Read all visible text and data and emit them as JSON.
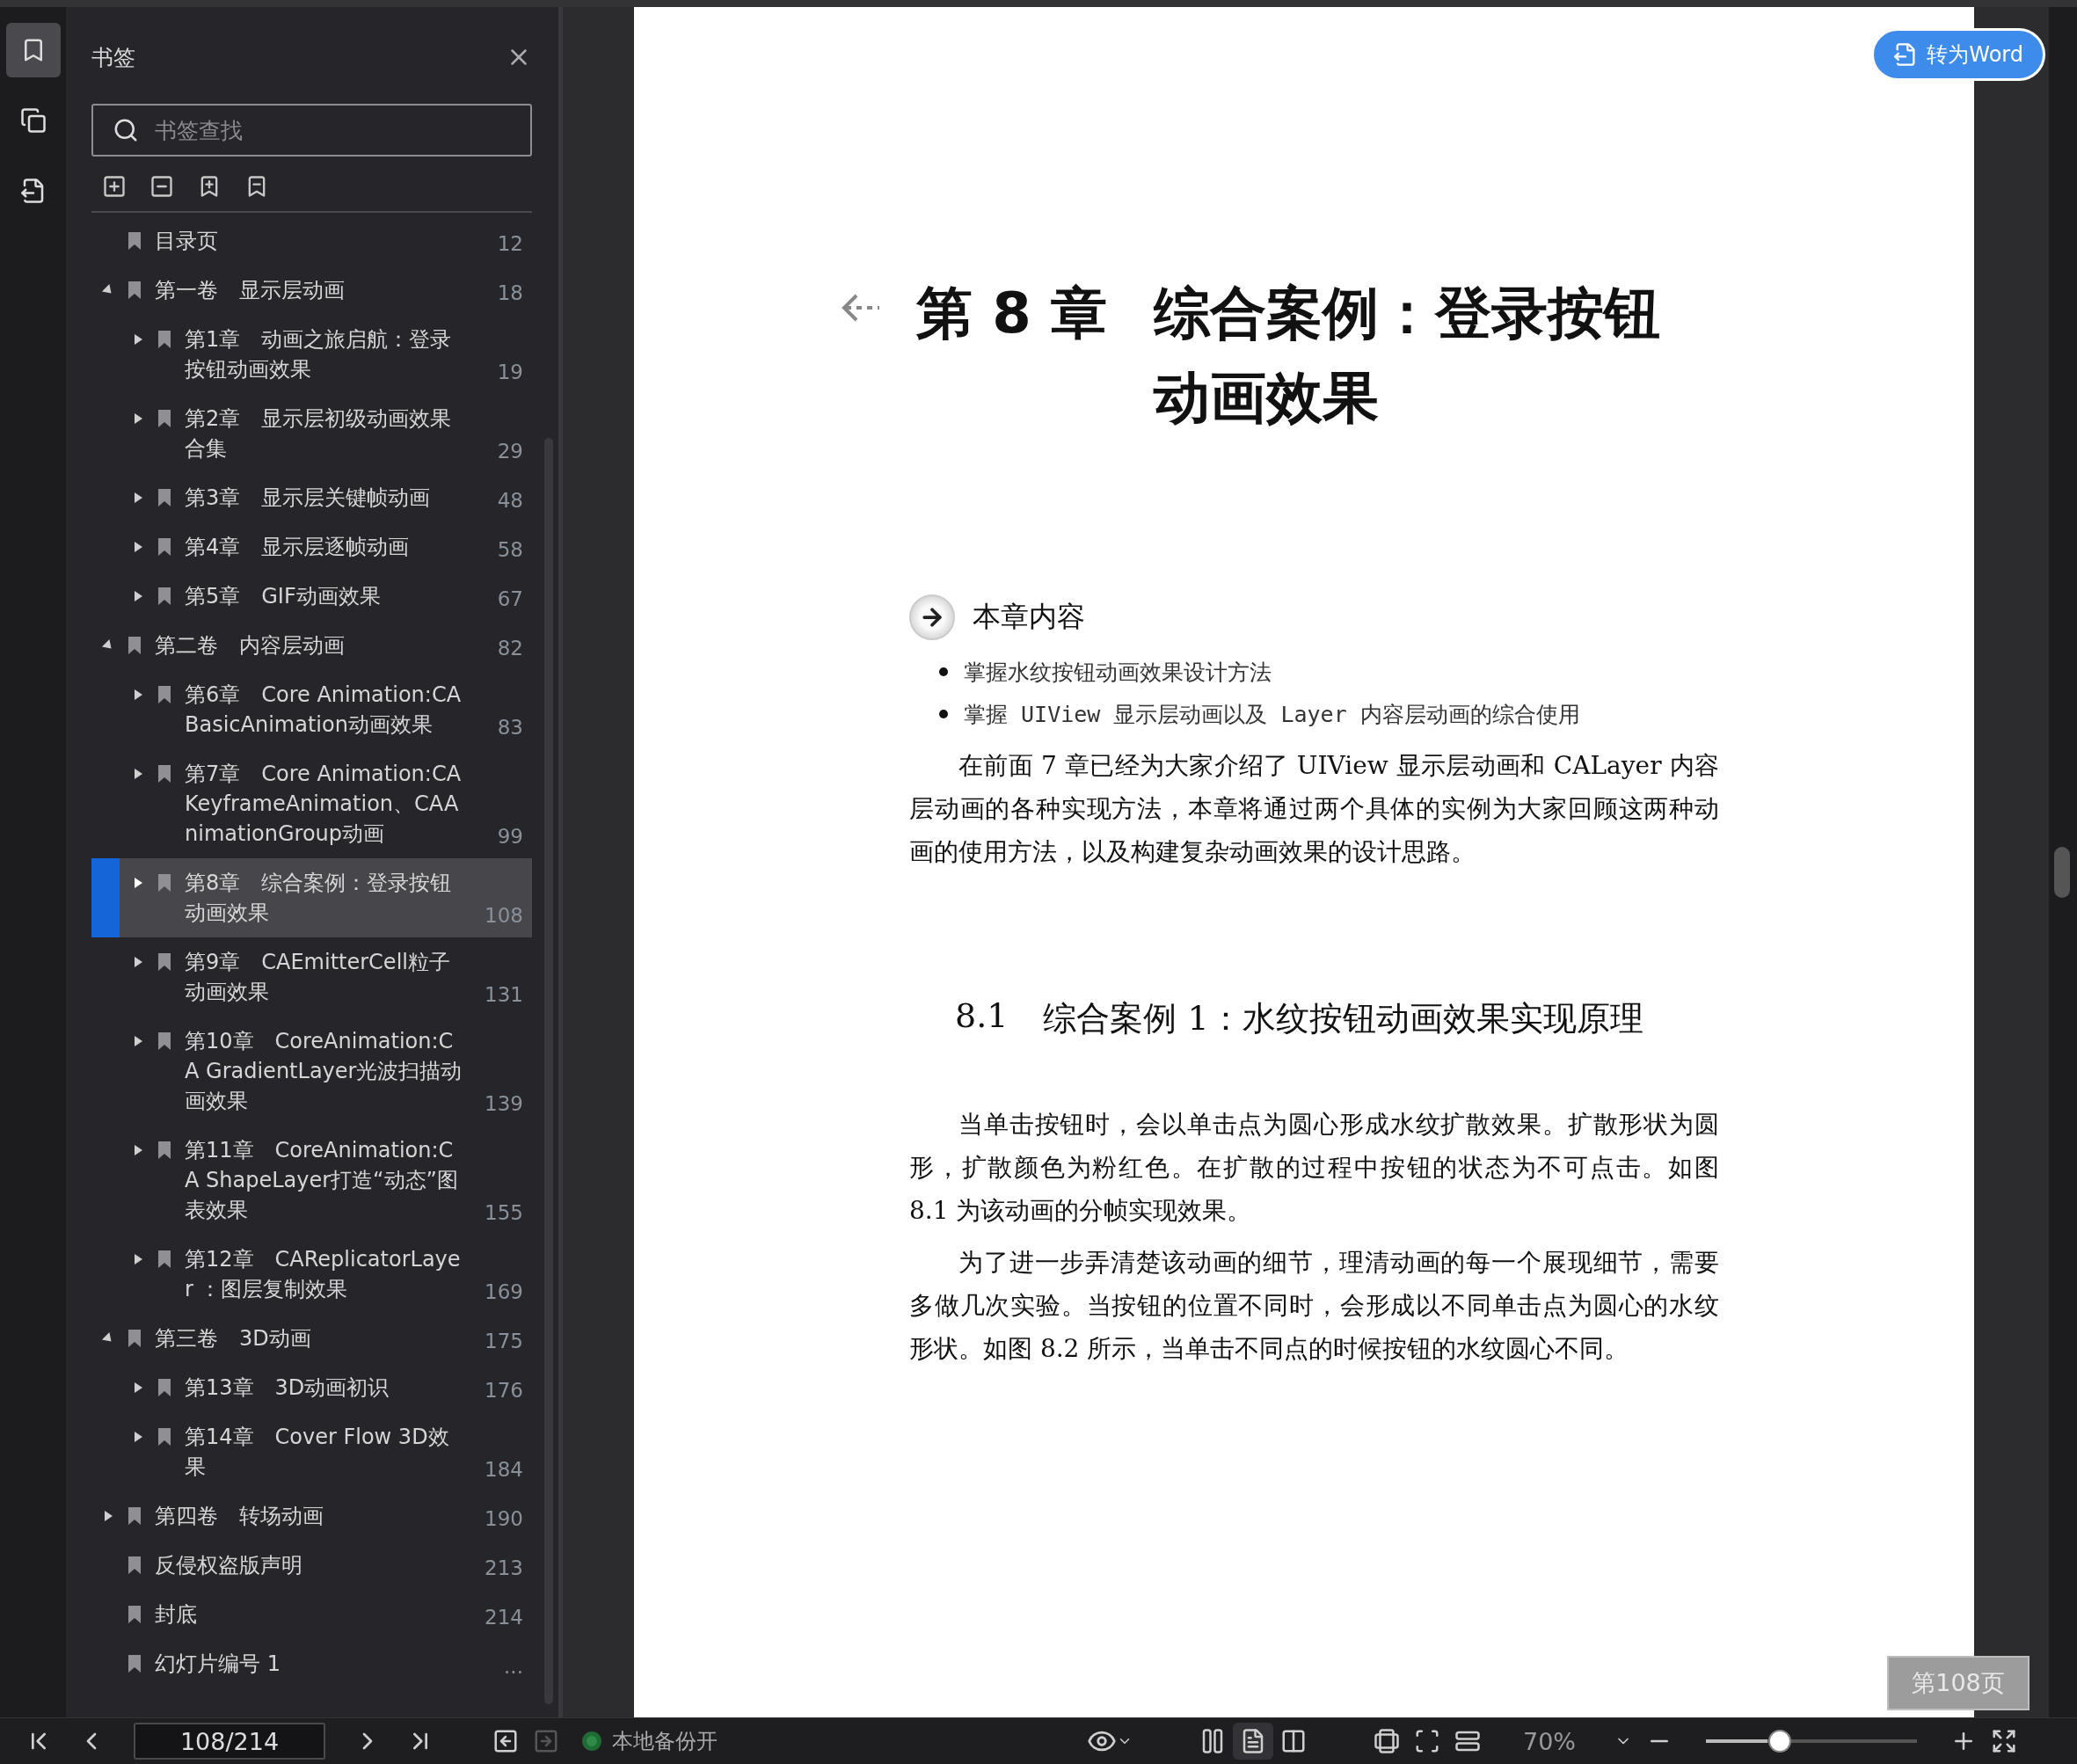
{
  "sidebar": {
    "rail": [
      {
        "kind": "bookmarks",
        "selected": true
      },
      {
        "kind": "pages",
        "selected": false
      },
      {
        "kind": "convert",
        "selected": false
      }
    ],
    "title": "书签",
    "search": {
      "placeholder": "书签查找"
    },
    "bookmarks": [
      {
        "title": "目录页",
        "page": "12",
        "kind": "leaf",
        "selected": false
      },
      {
        "title": "第一卷　显示层动画",
        "page": "18",
        "kind": "group",
        "expanded": true,
        "selected": false,
        "children": [
          {
            "title": "第1章　动画之旅启航：登录按钮动画效果",
            "page": "19",
            "kind": "group",
            "expanded": false,
            "selected": false
          },
          {
            "title": "第2章　显示层初级动画效果合集",
            "page": "29",
            "kind": "group",
            "expanded": false,
            "selected": false
          },
          {
            "title": "第3章　显示层关键帧动画",
            "page": "48",
            "kind": "group",
            "expanded": false,
            "selected": false
          },
          {
            "title": "第4章　显示层逐帧动画",
            "page": "58",
            "kind": "group",
            "expanded": false,
            "selected": false
          },
          {
            "title": "第5章　GIF动画效果",
            "page": "67",
            "kind": "group",
            "expanded": false,
            "selected": false
          }
        ]
      },
      {
        "title": "第二卷　内容层动画",
        "page": "82",
        "kind": "group",
        "expanded": true,
        "selected": false,
        "children": [
          {
            "title": "第6章　Core Animation:CA BasicAnimation动画效果",
            "page": "83",
            "kind": "group",
            "expanded": false,
            "selected": false
          },
          {
            "title": "第7章　Core Animation:CA KeyframeAnimation、CAA nimationGroup动画",
            "page": "99",
            "kind": "group",
            "expanded": false,
            "selected": false
          },
          {
            "title": "第8章　综合案例：登录按钮动画效果",
            "page": "108",
            "kind": "group",
            "expanded": false,
            "selected": true
          },
          {
            "title": "第9章　CAEmitterCell粒子动画效果",
            "page": "131",
            "kind": "group",
            "expanded": false,
            "selected": false
          },
          {
            "title": "第10章　CoreAnimation:CA GradientLayer光波扫描动画效果",
            "page": "139",
            "kind": "group",
            "expanded": false,
            "selected": false
          },
          {
            "title": "第11章　CoreAnimation:CA ShapeLayer打造“动态”图表效果",
            "page": "155",
            "kind": "group",
            "expanded": false,
            "selected": false
          },
          {
            "title": "第12章　CAReplicatorLayer ：图层复制效果",
            "page": "169",
            "kind": "group",
            "expanded": false,
            "selected": false
          }
        ]
      },
      {
        "title": "第三卷　3D动画",
        "page": "175",
        "kind": "group",
        "expanded": true,
        "selected": false,
        "children": [
          {
            "title": "第13章　3D动画初识",
            "page": "176",
            "kind": "group",
            "expanded": false,
            "selected": false
          },
          {
            "title": "第14章　Cover Flow 3D效果",
            "page": "184",
            "kind": "group",
            "expanded": false,
            "selected": false
          }
        ]
      },
      {
        "title": "第四卷　转场动画",
        "page": "190",
        "kind": "group",
        "expanded": false,
        "selected": false
      },
      {
        "title": "反侵权盗版声明",
        "page": "213",
        "kind": "leaf",
        "selected": false
      },
      {
        "title": "封底",
        "page": "214",
        "kind": "leaf",
        "selected": false
      },
      {
        "title": "幻灯片编号 1",
        "page": "...",
        "kind": "leaf",
        "selected": false
      }
    ]
  },
  "document": {
    "word_button": "转为Word",
    "chapter_label": "第 8 章",
    "chapter_title": "综合案例：登录按钮动画效果",
    "contents_heading": "本章内容",
    "objectives": [
      "掌握水纹按钮动画效果设计方法",
      "掌握 UIView 显示层动画以及 Layer 内容层动画的综合使用"
    ],
    "intro": "在前面 7 章已经为大家介绍了 UIView 显示层动画和 CALayer 内容层动画的各种实现方法，本章将通过两个具体的实例为大家回顾这两种动画的使用方法，以及构建复杂动画效果的设计思路。",
    "section_heading": {
      "number": "8.1",
      "title": "综合案例 1：水纹按钮动画效果实现原理"
    },
    "paragraphs": [
      "当单击按钮时，会以单击点为圆心形成水纹扩散效果。扩散形状为圆形，扩散颜色为粉红色。在扩散的过程中按钮的状态为不可点击。如图 8.1 为该动画的分帧实现效果。",
      "为了进一步弄清楚该动画的细节，理清动画的每一个展现细节，需要多做几次实验。当按钮的位置不同时，会形成以不同单击点为圆心的水纹形状。如图 8.2 所示，当单击不同点的时候按钮的水纹圆心不同。"
    ],
    "page_badge": "第108页"
  },
  "toolbar": {
    "page_field": "108/214",
    "forward_disabled": true,
    "backup": {
      "label": "本地备份开",
      "on": true
    },
    "view_modes": [
      {
        "kind": "continuous",
        "selected": false
      },
      {
        "kind": "single",
        "selected": true
      },
      {
        "kind": "double",
        "selected": false
      }
    ],
    "zoom": "70%",
    "zoom_slider": {
      "level": 0.35
    }
  }
}
